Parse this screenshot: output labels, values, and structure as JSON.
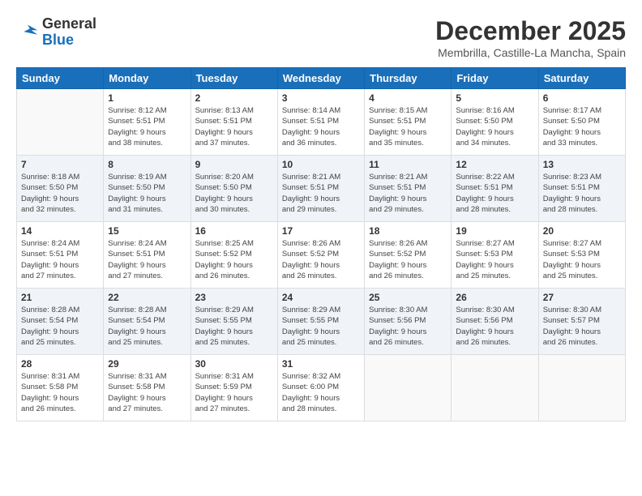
{
  "header": {
    "logo": {
      "general": "General",
      "blue": "Blue"
    },
    "title": "December 2025",
    "location": "Membrilla, Castille-La Mancha, Spain"
  },
  "calendar": {
    "days_of_week": [
      "Sunday",
      "Monday",
      "Tuesday",
      "Wednesday",
      "Thursday",
      "Friday",
      "Saturday"
    ],
    "weeks": [
      [
        {
          "day": "",
          "info": ""
        },
        {
          "day": "1",
          "info": "Sunrise: 8:12 AM\nSunset: 5:51 PM\nDaylight: 9 hours\nand 38 minutes."
        },
        {
          "day": "2",
          "info": "Sunrise: 8:13 AM\nSunset: 5:51 PM\nDaylight: 9 hours\nand 37 minutes."
        },
        {
          "day": "3",
          "info": "Sunrise: 8:14 AM\nSunset: 5:51 PM\nDaylight: 9 hours\nand 36 minutes."
        },
        {
          "day": "4",
          "info": "Sunrise: 8:15 AM\nSunset: 5:51 PM\nDaylight: 9 hours\nand 35 minutes."
        },
        {
          "day": "5",
          "info": "Sunrise: 8:16 AM\nSunset: 5:50 PM\nDaylight: 9 hours\nand 34 minutes."
        },
        {
          "day": "6",
          "info": "Sunrise: 8:17 AM\nSunset: 5:50 PM\nDaylight: 9 hours\nand 33 minutes."
        }
      ],
      [
        {
          "day": "7",
          "info": "Sunrise: 8:18 AM\nSunset: 5:50 PM\nDaylight: 9 hours\nand 32 minutes."
        },
        {
          "day": "8",
          "info": "Sunrise: 8:19 AM\nSunset: 5:50 PM\nDaylight: 9 hours\nand 31 minutes."
        },
        {
          "day": "9",
          "info": "Sunrise: 8:20 AM\nSunset: 5:50 PM\nDaylight: 9 hours\nand 30 minutes."
        },
        {
          "day": "10",
          "info": "Sunrise: 8:21 AM\nSunset: 5:51 PM\nDaylight: 9 hours\nand 29 minutes."
        },
        {
          "day": "11",
          "info": "Sunrise: 8:21 AM\nSunset: 5:51 PM\nDaylight: 9 hours\nand 29 minutes."
        },
        {
          "day": "12",
          "info": "Sunrise: 8:22 AM\nSunset: 5:51 PM\nDaylight: 9 hours\nand 28 minutes."
        },
        {
          "day": "13",
          "info": "Sunrise: 8:23 AM\nSunset: 5:51 PM\nDaylight: 9 hours\nand 28 minutes."
        }
      ],
      [
        {
          "day": "14",
          "info": "Sunrise: 8:24 AM\nSunset: 5:51 PM\nDaylight: 9 hours\nand 27 minutes."
        },
        {
          "day": "15",
          "info": "Sunrise: 8:24 AM\nSunset: 5:51 PM\nDaylight: 9 hours\nand 27 minutes."
        },
        {
          "day": "16",
          "info": "Sunrise: 8:25 AM\nSunset: 5:52 PM\nDaylight: 9 hours\nand 26 minutes."
        },
        {
          "day": "17",
          "info": "Sunrise: 8:26 AM\nSunset: 5:52 PM\nDaylight: 9 hours\nand 26 minutes."
        },
        {
          "day": "18",
          "info": "Sunrise: 8:26 AM\nSunset: 5:52 PM\nDaylight: 9 hours\nand 26 minutes."
        },
        {
          "day": "19",
          "info": "Sunrise: 8:27 AM\nSunset: 5:53 PM\nDaylight: 9 hours\nand 25 minutes."
        },
        {
          "day": "20",
          "info": "Sunrise: 8:27 AM\nSunset: 5:53 PM\nDaylight: 9 hours\nand 25 minutes."
        }
      ],
      [
        {
          "day": "21",
          "info": "Sunrise: 8:28 AM\nSunset: 5:54 PM\nDaylight: 9 hours\nand 25 minutes."
        },
        {
          "day": "22",
          "info": "Sunrise: 8:28 AM\nSunset: 5:54 PM\nDaylight: 9 hours\nand 25 minutes."
        },
        {
          "day": "23",
          "info": "Sunrise: 8:29 AM\nSunset: 5:55 PM\nDaylight: 9 hours\nand 25 minutes."
        },
        {
          "day": "24",
          "info": "Sunrise: 8:29 AM\nSunset: 5:55 PM\nDaylight: 9 hours\nand 25 minutes."
        },
        {
          "day": "25",
          "info": "Sunrise: 8:30 AM\nSunset: 5:56 PM\nDaylight: 9 hours\nand 26 minutes."
        },
        {
          "day": "26",
          "info": "Sunrise: 8:30 AM\nSunset: 5:56 PM\nDaylight: 9 hours\nand 26 minutes."
        },
        {
          "day": "27",
          "info": "Sunrise: 8:30 AM\nSunset: 5:57 PM\nDaylight: 9 hours\nand 26 minutes."
        }
      ],
      [
        {
          "day": "28",
          "info": "Sunrise: 8:31 AM\nSunset: 5:58 PM\nDaylight: 9 hours\nand 26 minutes."
        },
        {
          "day": "29",
          "info": "Sunrise: 8:31 AM\nSunset: 5:58 PM\nDaylight: 9 hours\nand 27 minutes."
        },
        {
          "day": "30",
          "info": "Sunrise: 8:31 AM\nSunset: 5:59 PM\nDaylight: 9 hours\nand 27 minutes."
        },
        {
          "day": "31",
          "info": "Sunrise: 8:32 AM\nSunset: 6:00 PM\nDaylight: 9 hours\nand 28 minutes."
        },
        {
          "day": "",
          "info": ""
        },
        {
          "day": "",
          "info": ""
        },
        {
          "day": "",
          "info": ""
        }
      ]
    ]
  }
}
